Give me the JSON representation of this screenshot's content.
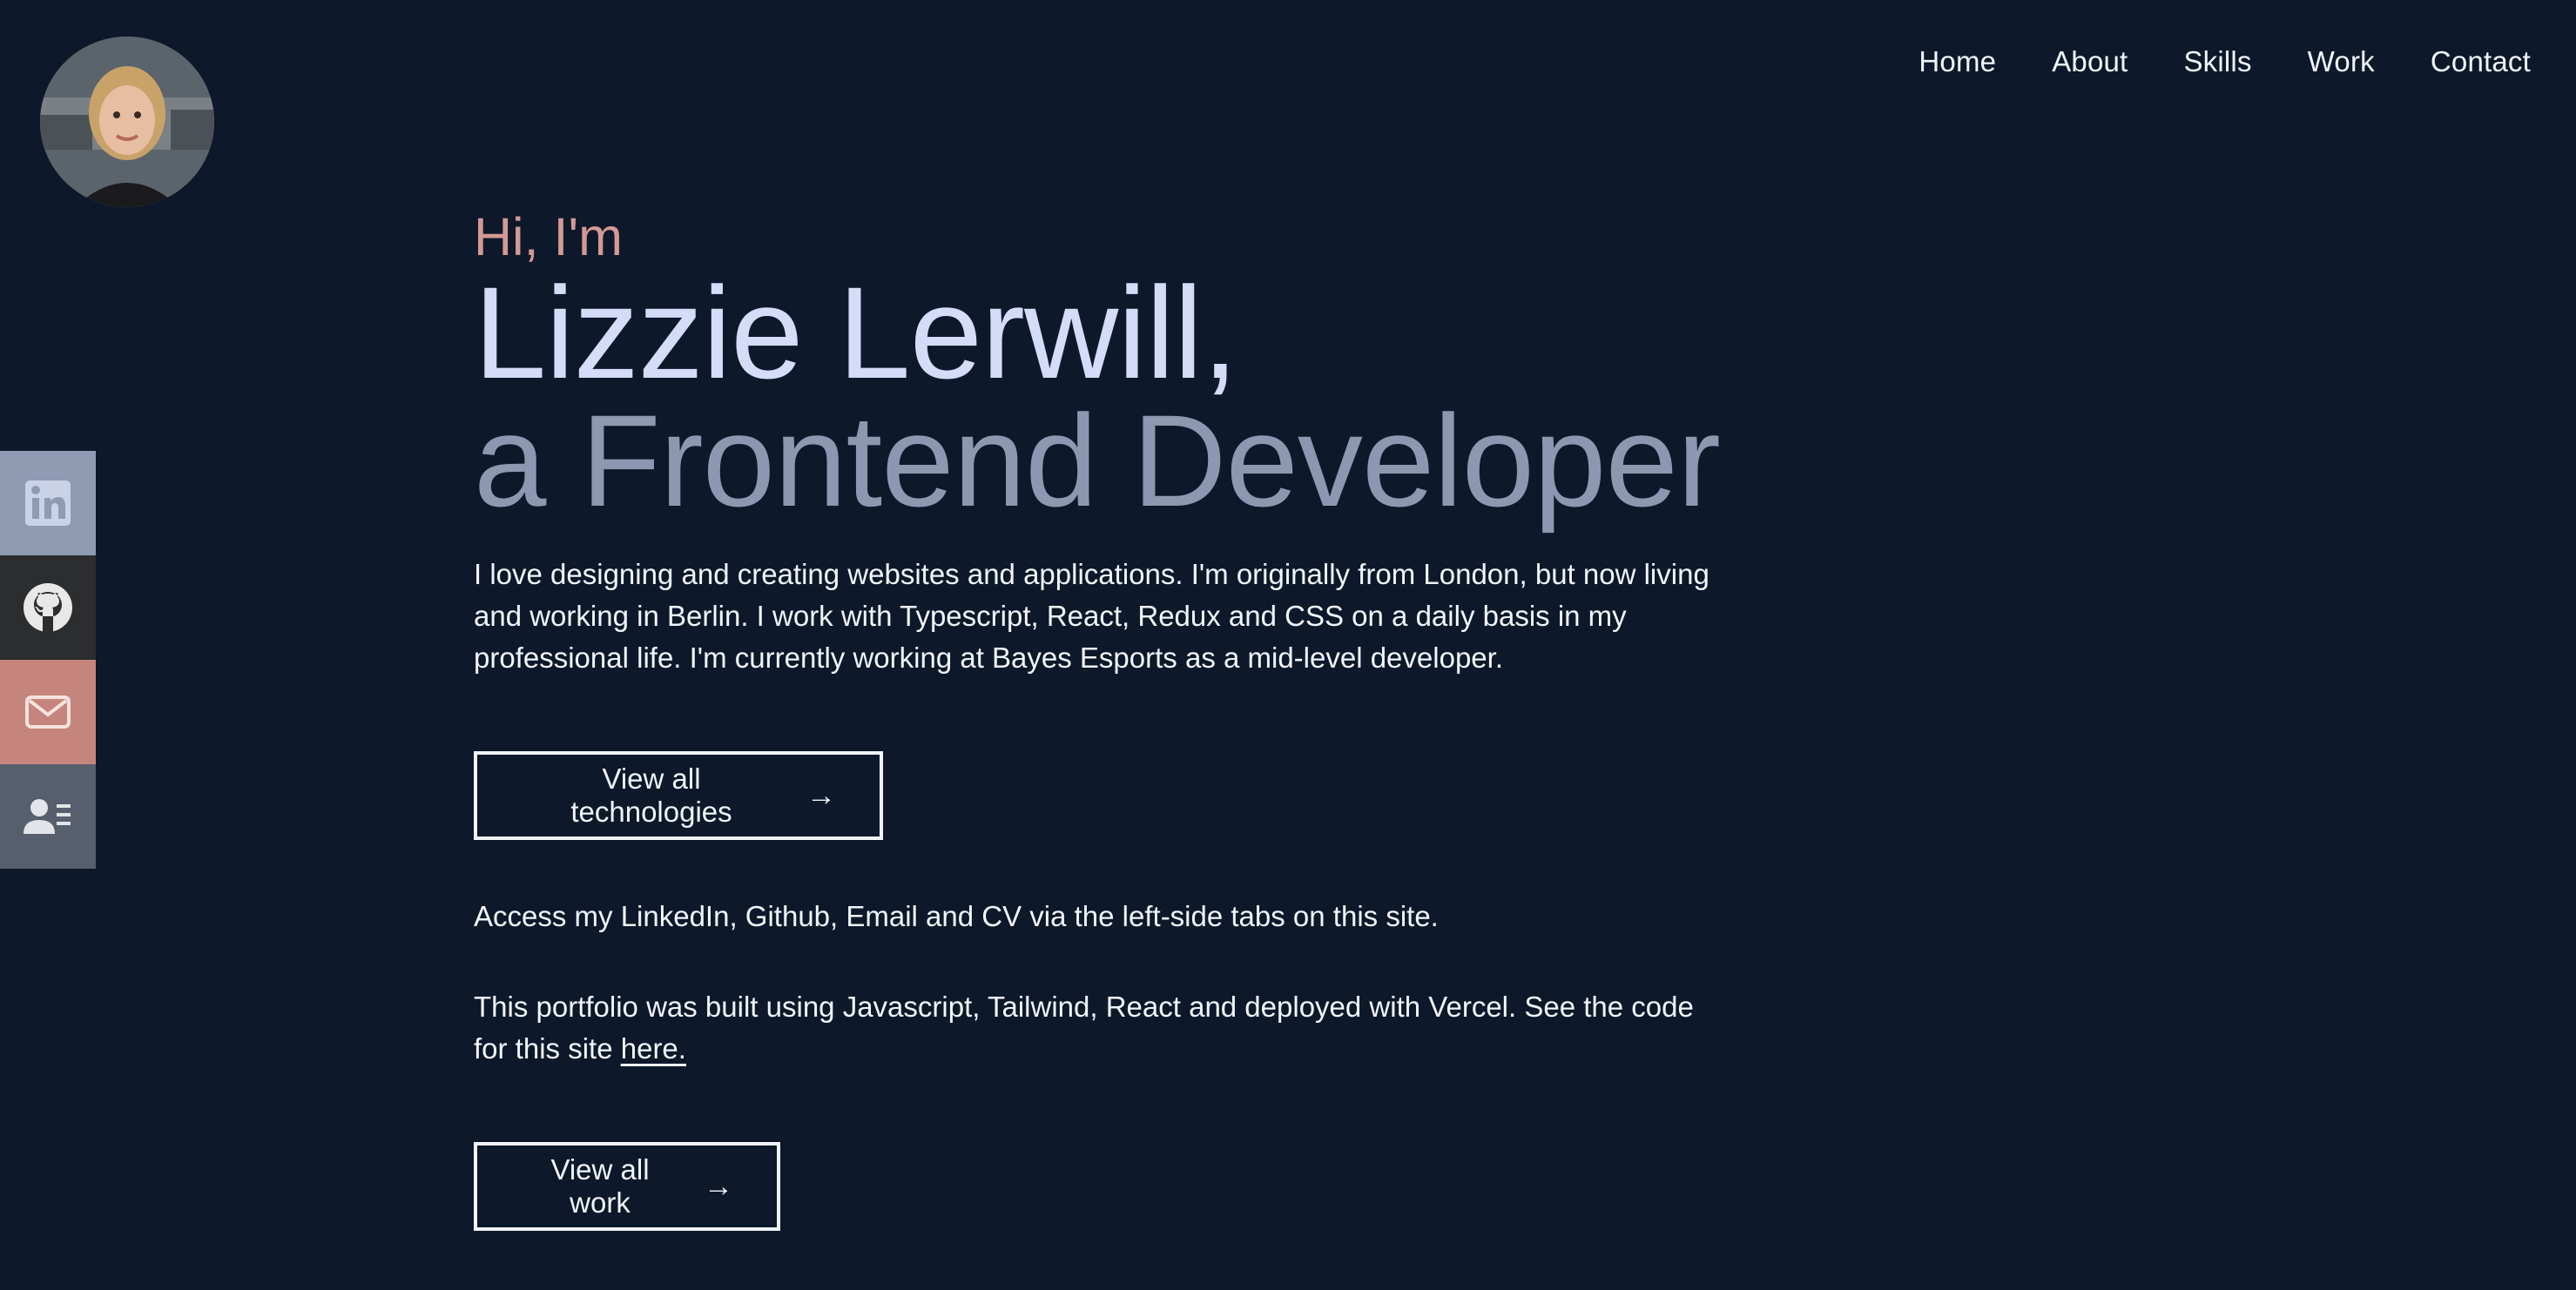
{
  "nav": {
    "items": [
      {
        "label": "Home"
      },
      {
        "label": "About"
      },
      {
        "label": "Skills"
      },
      {
        "label": "Work"
      },
      {
        "label": "Contact"
      }
    ]
  },
  "side_tabs": [
    {
      "icon": "linkedin-icon",
      "color": "#8f9ab3"
    },
    {
      "icon": "github-icon",
      "color": "#2c2d2f"
    },
    {
      "icon": "email-icon",
      "color": "#c5857c"
    },
    {
      "icon": "cv-icon",
      "color": "#575e6d"
    }
  ],
  "hero": {
    "greeting": "Hi, I'm",
    "name": "Lizzie Lerwill,",
    "role": "a Frontend Developer",
    "intro": "I love designing and creating websites and applications. I'm originally from London, but now living and working in Berlin. I work with Typescript, React, Redux and CSS on a daily basis in my professional life. I'm currently working at Bayes Esports as a mid-level developer.",
    "tech_button": "View all technologies",
    "arrow": "→",
    "access_text": "Access my LinkedIn, Github, Email and CV via the left-side tabs on this site.",
    "built_text": "This portfolio was built using Javascript, Tailwind, React and deployed with Vercel. See the code for this site ",
    "here_link": "here.",
    "work_button": "View all work"
  },
  "colors": {
    "background": "#0e182b",
    "greeting": "#d39a93",
    "name": "#d4dcf7",
    "role": "#8d97b0",
    "text": "#f1f5fb"
  }
}
